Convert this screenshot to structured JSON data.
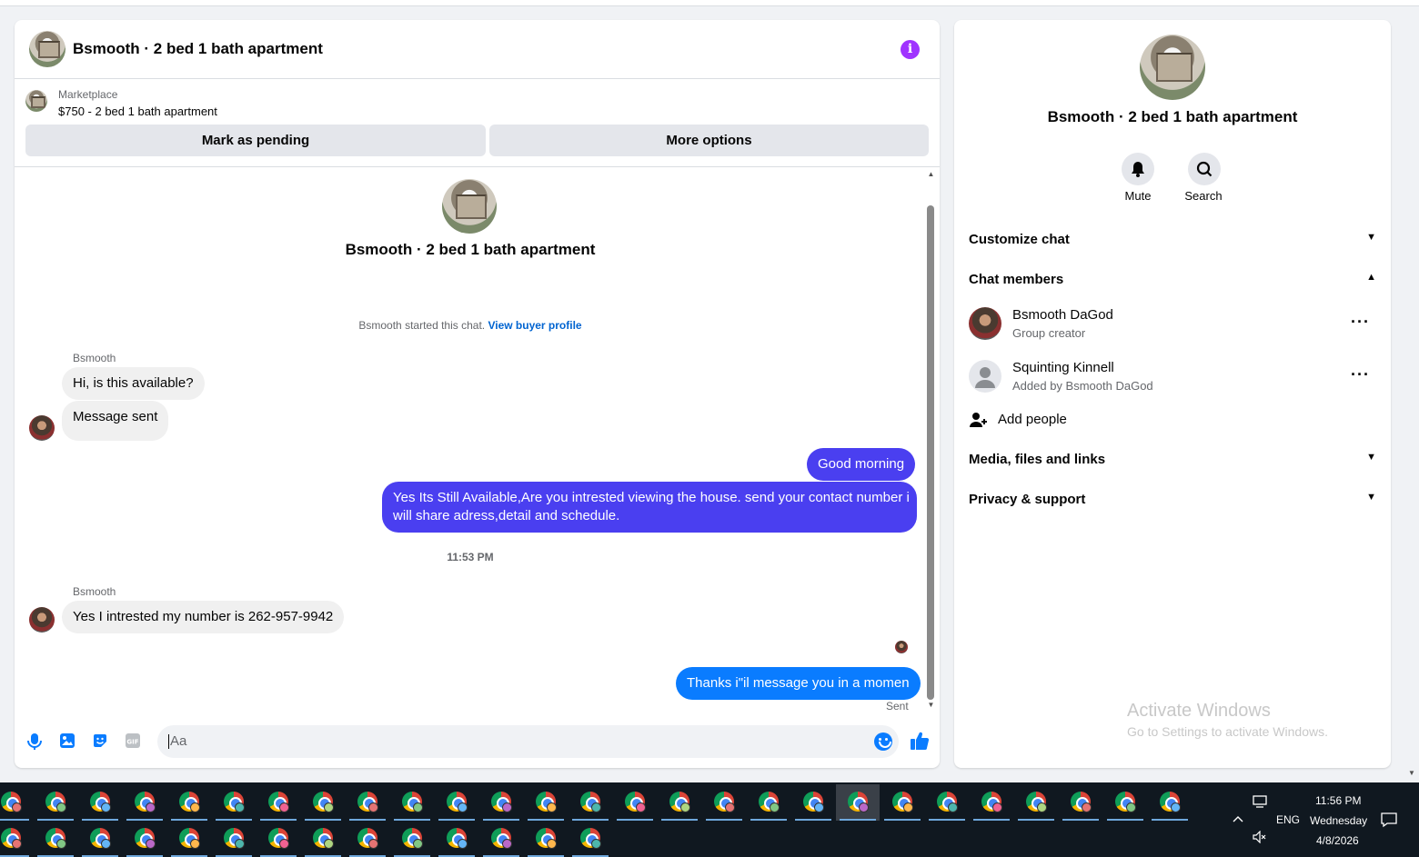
{
  "header": {
    "title": "Bsmooth · 2 bed 1 bath apartment"
  },
  "listing": {
    "label": "Marketplace",
    "price_title": "$750 - 2 bed 1 bath apartment"
  },
  "actions": {
    "pending": "Mark as pending",
    "more": "More options"
  },
  "conversation": {
    "title": "Bsmooth · 2 bed 1 bath apartment",
    "started_text": "Bsmooth started this chat.",
    "buyer_link": "View buyer profile",
    "messages": [
      {
        "sender": "Bsmooth",
        "text": "Hi, is this available?"
      },
      {
        "text": "Message sent"
      },
      {
        "text": "Good morning"
      },
      {
        "text": "Yes Its Still Available,Are you intrested viewing the house. send your contact number i",
        "text2": "will share adress,detail and schedule."
      },
      {
        "sender": "Bsmooth",
        "text": "Yes I intrested my number is 262-957-9942"
      },
      {
        "text": "Thanks i\"il message you in a momen"
      }
    ],
    "timestamp": "11:53 PM",
    "status": "Sent"
  },
  "composer": {
    "placeholder": "Aa"
  },
  "panel": {
    "title": "Bsmooth · 2 bed 1 bath apartment",
    "mute": "Mute",
    "search": "Search",
    "customize": "Customize chat",
    "members_heading": "Chat members",
    "members": [
      {
        "name": "Bsmooth DaGod",
        "sub": "Group creator"
      },
      {
        "name": "Squinting Kinnell",
        "sub": "Added by Bsmooth DaGod"
      }
    ],
    "add_people": "Add people",
    "media": "Media, files and links",
    "privacy": "Privacy & support"
  },
  "watermark": {
    "line1": "Activate Windows",
    "line2": "Go to Settings to activate Windows."
  },
  "taskbar": {
    "time": "11:56 PM",
    "day": "Wednesday",
    "date": "4/8/2026",
    "lang": "ENG"
  },
  "colors": {
    "accent": "#0a7cff",
    "outgoing": "#4a3ff0",
    "info": "#a033ff"
  }
}
